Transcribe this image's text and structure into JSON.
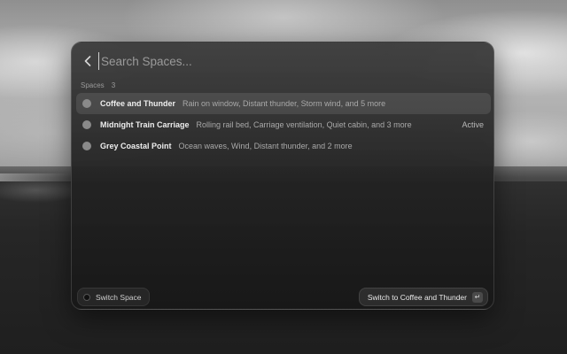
{
  "search": {
    "placeholder": "Search Spaces..."
  },
  "section": {
    "title": "Spaces",
    "count": "3"
  },
  "spaces": [
    {
      "name": "Coffee and Thunder",
      "description": "Rain on window, Distant thunder, Storm wind, and 5 more",
      "status": ""
    },
    {
      "name": "Midnight Train Carriage",
      "description": "Rolling rail bed, Carriage ventilation, Quiet cabin, and 3 more",
      "status": "Active"
    },
    {
      "name": "Grey Coastal Point",
      "description": "Ocean waves, Wind, Distant thunder, and 2 more",
      "status": ""
    }
  ],
  "footer": {
    "left_label": "Switch Space",
    "right_label": "Switch to Coffee and Thunder",
    "enter_key": "↵"
  },
  "icons": {
    "back": "chevron-left-icon",
    "enter": "return-key-icon"
  }
}
